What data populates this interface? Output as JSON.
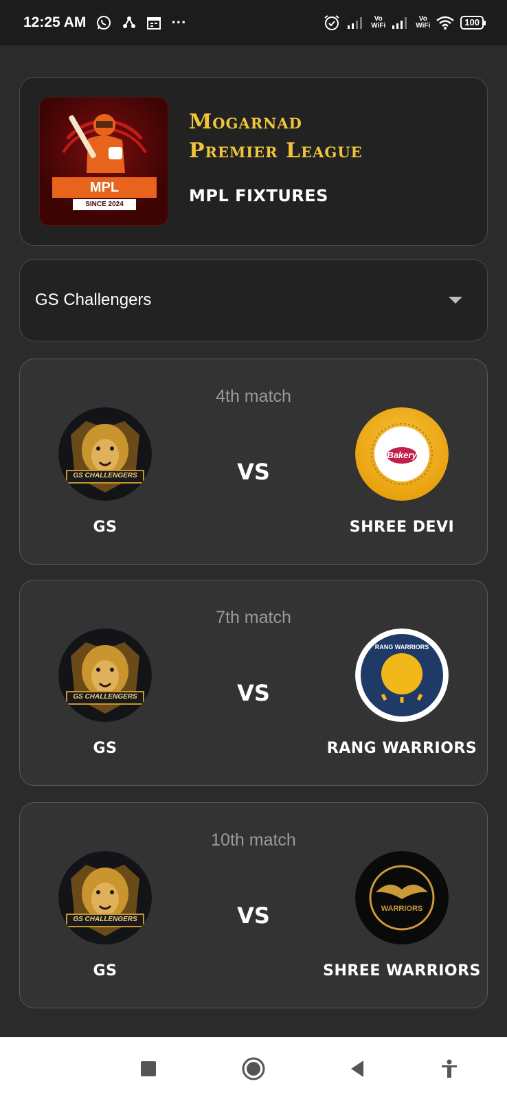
{
  "status": {
    "time": "12:25 AM",
    "more": "···",
    "wifi_label_1": "Vo\nWiFi",
    "wifi_label_2": "Vo\nWiFi",
    "battery": "100"
  },
  "header": {
    "logo_text": "MPL",
    "logo_since": "SINCE 2024",
    "title_line1": "Mogarnad",
    "title_line2": "Premier League",
    "subtitle": "MPL FIXTURES"
  },
  "team_select": {
    "value": "GS Challengers"
  },
  "matches": [
    {
      "number": "4th match",
      "home": "GS",
      "home_logo_text": "GS CHALLENGERS",
      "vs": "VS",
      "away": "SHREE DEVI",
      "away_logo_text": "Bakery"
    },
    {
      "number": "7th match",
      "home": "GS",
      "home_logo_text": "GS CHALLENGERS",
      "vs": "VS",
      "away": "RANG WARRIORS",
      "away_logo_text": "RANG WARRIORS"
    },
    {
      "number": "10th match",
      "home": "GS",
      "home_logo_text": "GS CHALLENGERS",
      "vs": "VS",
      "away": "SHREE WARRIORS",
      "away_logo_text": "WARRIORS"
    }
  ],
  "colors": {
    "accent_gold": "#f0c53a",
    "background": "#2b2b2b",
    "card": "#333333"
  }
}
